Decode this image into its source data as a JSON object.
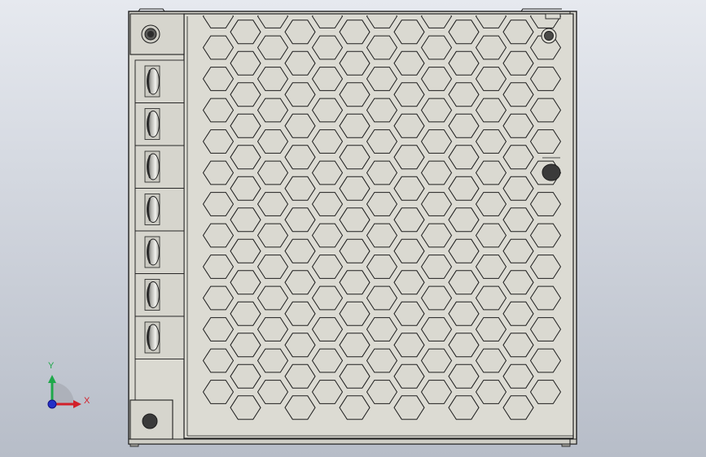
{
  "colors": {
    "background_top": "#e6e9ef",
    "background_bottom": "#b7bdc8",
    "part_face": "#dad9d1",
    "part_edge": "#1e1e1e",
    "hole_fill": "#dad9d1",
    "screw_dark": "#3a3a3a",
    "axis_x": "#d2202a",
    "axis_y": "#1ea84a",
    "axis_z": "#2430c8"
  },
  "triad": {
    "x_label": "X",
    "y_label": "Y"
  },
  "model": {
    "terminal_count": 7,
    "vent_pattern": "hexagonal",
    "vent_rows": 25
  }
}
